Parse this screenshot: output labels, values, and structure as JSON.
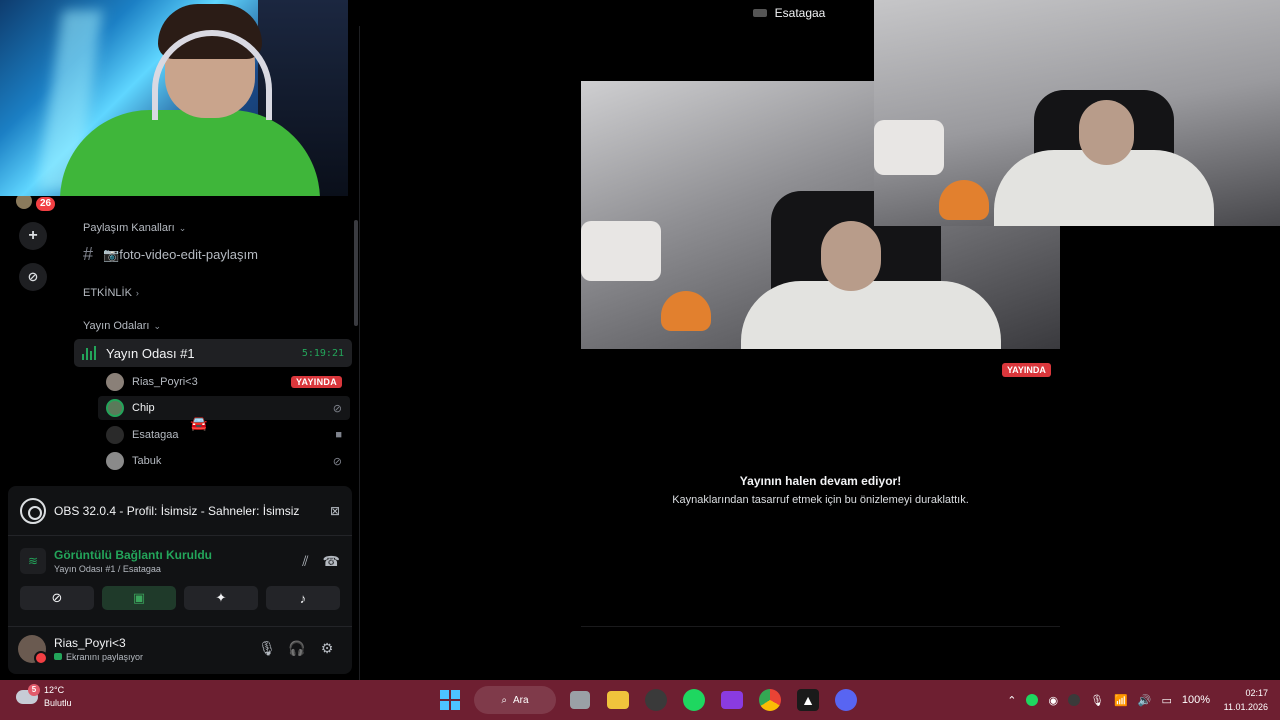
{
  "topbar": {
    "title": "Esatagaa"
  },
  "server_rail": {
    "badge_count": "26",
    "add_icon": "+",
    "discover_icon": "⊘"
  },
  "channels": {
    "category_share": "Paylaşım Kanalları",
    "text_channel": "📷foto-video-edit-paylaşım",
    "category_events": "ETKİNLİK",
    "category_voice": "Yayın Odaları",
    "voice_channel": {
      "name": "Yayın Odası #1",
      "timer": "5:19:21"
    },
    "users": [
      {
        "name": "Rias_Poyri<3",
        "badge": "YAYINDA",
        "avatar_color": "#8a8078"
      },
      {
        "name": "Chip",
        "state_icon": "⊘",
        "avatar_color": "#5a7a5a"
      },
      {
        "name": "Esatagaa",
        "state_icon": "■",
        "avatar_color": "#444"
      },
      {
        "name": "Tabuk",
        "state_icon": "⊘",
        "avatar_color": "#8a8a8a"
      }
    ]
  },
  "panel": {
    "activity": "OBS 32.0.4 - Profil: İsimsiz - Sahneler: İsimsiz",
    "connection_title": "Görüntülü Bağlantı Kuruldu",
    "connection_sub": "Yayın Odası #1 / Esatagaa",
    "user_name": "Rias_Poyri<3",
    "user_status": "Ekranını paylaşıyor"
  },
  "stream": {
    "live_badge": "YAYINDA",
    "paused_title": "Yayının halen devam ediyor!",
    "paused_sub": "Kaynaklarından tasarruf etmek için bu önizlemeyi duraklattık."
  },
  "taskbar": {
    "weather_temp": "12°C",
    "weather_desc": "Bulutlu",
    "weather_badge": "5",
    "search_label": "Ara",
    "battery": "100%",
    "time": "02:17",
    "date": "11.01.2026"
  }
}
